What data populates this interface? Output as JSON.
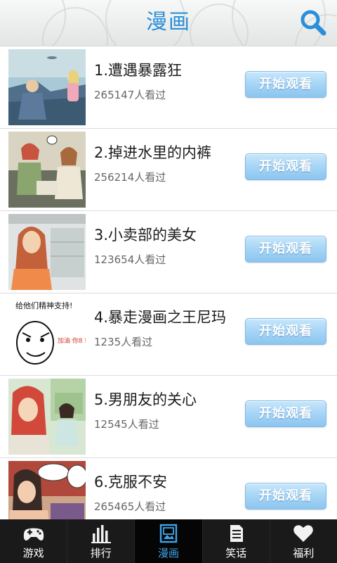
{
  "header": {
    "title": "漫画",
    "search_icon": "search-icon"
  },
  "list": {
    "items": [
      {
        "title": "1.遭遇暴露狂",
        "views": "265147人看过",
        "button": "开始观看"
      },
      {
        "title": "2.掉进水里的内裤",
        "views": "256214人看过",
        "button": "开始观看"
      },
      {
        "title": "3.小卖部的美女",
        "views": "123654人看过",
        "button": "开始观看"
      },
      {
        "title": "4.暴走漫画之王尼玛",
        "views": "1235人看过",
        "button": "开始观看",
        "thumb_caption": "给他们精神支持!",
        "thumb_speech": "加油 你8 就列!"
      },
      {
        "title": "5.男朋友的关心",
        "views": "12545人看过",
        "button": "开始观看"
      },
      {
        "title": "6.克服不安",
        "views": "265465人看过",
        "button": "开始观看"
      }
    ]
  },
  "tabbar": {
    "tabs": [
      {
        "label": "游戏",
        "icon": "gamepad-icon"
      },
      {
        "label": "排行",
        "icon": "bar-chart-icon"
      },
      {
        "label": "漫画",
        "icon": "picture-icon"
      },
      {
        "label": "笑话",
        "icon": "document-icon"
      },
      {
        "label": "福利",
        "icon": "heart-icon"
      }
    ],
    "active_index": 2
  },
  "colors": {
    "accent": "#2b8fd8",
    "button": "#a8d6f6",
    "tabbar": "#1a1a1a"
  }
}
